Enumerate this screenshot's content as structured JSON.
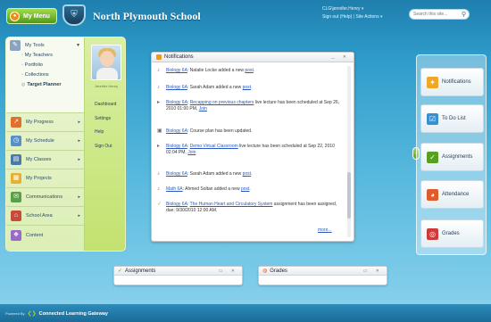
{
  "header": {
    "my_menu_label": "My Menu",
    "school_name": "North Plymouth School",
    "user_name": "CLG\\jennifer.Henry",
    "sign_out": "Sign out (Help)",
    "site_actions": "Site Actions",
    "search_placeholder": "Search this site..."
  },
  "menu": {
    "my_tools": "My Tools",
    "sub_items": [
      "My Teachers",
      "Portfolio",
      "Collections",
      "Target Planner"
    ],
    "items": [
      {
        "label": "My Progress"
      },
      {
        "label": "My Schedule"
      },
      {
        "label": "My Classes"
      },
      {
        "label": "My Projects"
      },
      {
        "label": "Communications"
      },
      {
        "label": "School Area"
      },
      {
        "label": "Content"
      }
    ],
    "profile_name": "Jennifer Henry",
    "links": [
      "Dashboard",
      "Settings",
      "Help",
      "Sign Out"
    ]
  },
  "notifications": {
    "title": "Notifications",
    "more": "more...",
    "items": [
      {
        "course": "Biology 6A",
        "text": ": Natalie Locke added a new ",
        "link": "post",
        "tail": ".",
        "link2": "",
        "tail2": ""
      },
      {
        "course": "Biology 6A",
        "text": ": Sarah Adam added a new ",
        "link": "post",
        "tail": ".",
        "link2": "",
        "tail2": ""
      },
      {
        "course": "Biology 6A",
        "text": ": ",
        "link": "Recapping on previous chapters",
        "tail": " live lecture has been scheduled at Sep 26, 2010 01:00 PM, ",
        "link2": "Join",
        "tail2": ""
      },
      {
        "course": "Biology 6A",
        "text": ": Course plan has been updated.",
        "link": "",
        "tail": "",
        "link2": "",
        "tail2": ""
      },
      {
        "course": "Biology 6A",
        "text": ": ",
        "link": "Demo Virtual Classroom",
        "tail": " live lecture has been scheduled at Sep 22, 2010 02:04 PM, ",
        "link2": "Join",
        "tail2": ""
      },
      {
        "course": "Biology 6A",
        "text": ": Sarah Adam added a new ",
        "link": "post",
        "tail": ".",
        "link2": "",
        "tail2": ""
      },
      {
        "course": "Math 6A",
        "text": ": Ahmed Soltan added a new ",
        "link": "post",
        "tail": ".",
        "link2": "",
        "tail2": ""
      },
      {
        "course": "Biology 6A",
        "text": ": ",
        "link": "The Human Heart and Circulatory System",
        "tail": " assignment has been assigned, due: 9/30/2010 12:00 AM.",
        "link2": "",
        "tail2": ""
      }
    ]
  },
  "rail": {
    "items": [
      {
        "label": "Notifications",
        "color": "#f2a623"
      },
      {
        "label": "To Do List",
        "color": "#3a8fd0"
      },
      {
        "label": "Assignments",
        "color": "#58a11f"
      },
      {
        "label": "Attendance",
        "color": "#e05a2a"
      },
      {
        "label": "Grades",
        "color": "#d23a3a"
      }
    ]
  },
  "widgets": {
    "assignments": "Assignments",
    "grades": "Grades"
  },
  "footer": {
    "powered_by": "Powered By",
    "brand": "Connected Learning Gateway"
  }
}
